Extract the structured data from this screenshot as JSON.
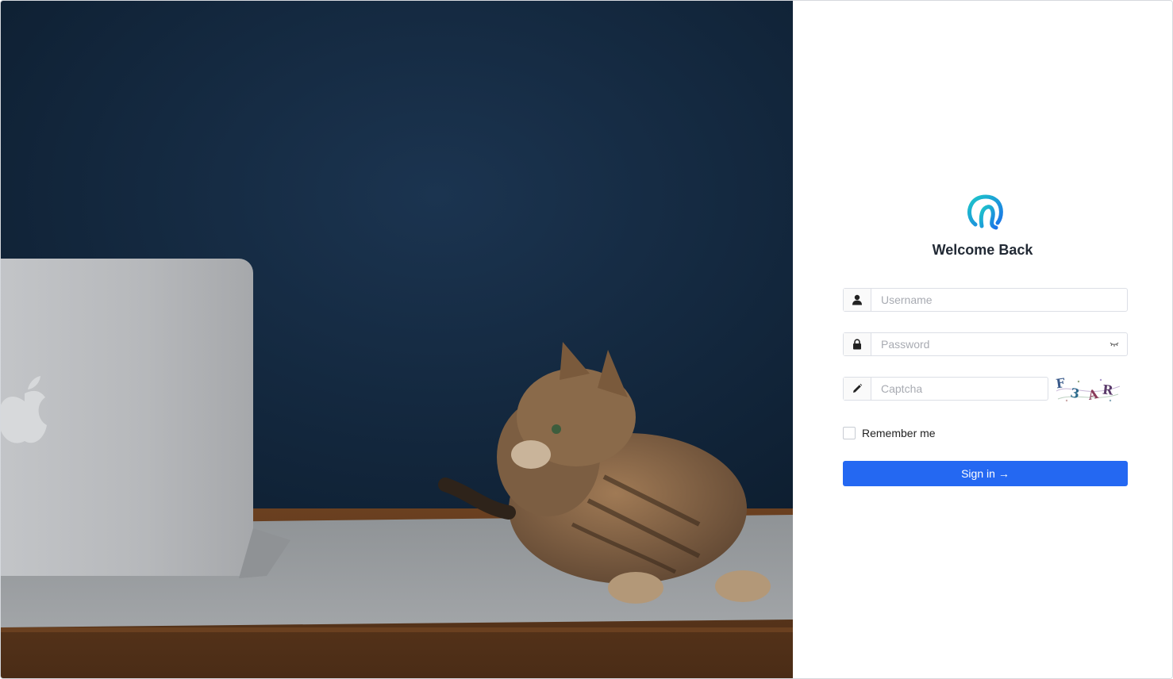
{
  "login": {
    "title": "Welcome Back",
    "username_placeholder": "Username",
    "password_placeholder": "Password",
    "captcha_placeholder": "Captcha",
    "captcha_text": "F3AR",
    "remember_label": "Remember me",
    "signin_label": "Sign in",
    "signin_arrow": "→"
  },
  "icons": {
    "username": "user-icon",
    "password": "lock-icon",
    "password_toggle": "eye-closed-icon",
    "captcha": "pencil-icon",
    "logo": "brand-logo-icon"
  },
  "colors": {
    "accent": "#2468f2",
    "logo_gradient_start": "#1ec8c8",
    "logo_gradient_end": "#1a73e8",
    "title_text": "#222a35",
    "photo_wall": "#14293f"
  }
}
